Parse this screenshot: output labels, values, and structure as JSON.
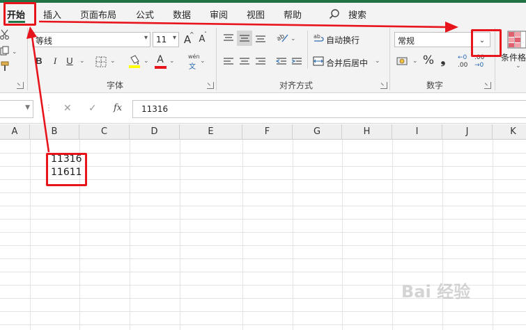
{
  "tabs": {
    "home": "开始",
    "insert": "插入",
    "page_layout": "页面布局",
    "formulas": "公式",
    "data": "数据",
    "review": "审阅",
    "view": "视图",
    "help": "帮助",
    "search": "搜索"
  },
  "ribbon": {
    "font_group": {
      "font_name": "等线",
      "font_size": "11",
      "grow_label": "A",
      "shrink_label": "A",
      "bold": "B",
      "italic": "I",
      "underline": "U",
      "font_color_label": "A",
      "phonetic_top": "wén",
      "phonetic_bottom": "文",
      "group_label": "字体"
    },
    "alignment_group": {
      "wrap_text": "自动换行",
      "merge_center": "合并后居中",
      "group_label": "对齐方式"
    },
    "number_group": {
      "format_value": "常规",
      "percent": "%",
      "comma": "❟",
      "inc_decimal_top": "←0",
      "inc_decimal_bottom": ".00",
      "dec_decimal_top": ".00",
      "dec_decimal_bottom": "→0",
      "group_label": "数字"
    },
    "styles_group": {
      "conditional_formatting": "条件格"
    }
  },
  "formula_bar": {
    "cancel": "✕",
    "enter": "✓",
    "fx": "fx",
    "value": "11316"
  },
  "grid": {
    "columns": [
      "A",
      "B",
      "C",
      "D",
      "E",
      "F",
      "G",
      "H",
      "I",
      "J",
      "K"
    ],
    "cells": {
      "B2": "11316",
      "B3": "11611"
    }
  },
  "watermark": "Bai 经验",
  "colors": {
    "accent": "#217346",
    "annotation": "#e8141b",
    "font_color_bar": "#e8141b",
    "fill_color_bar": "#ffff00"
  }
}
